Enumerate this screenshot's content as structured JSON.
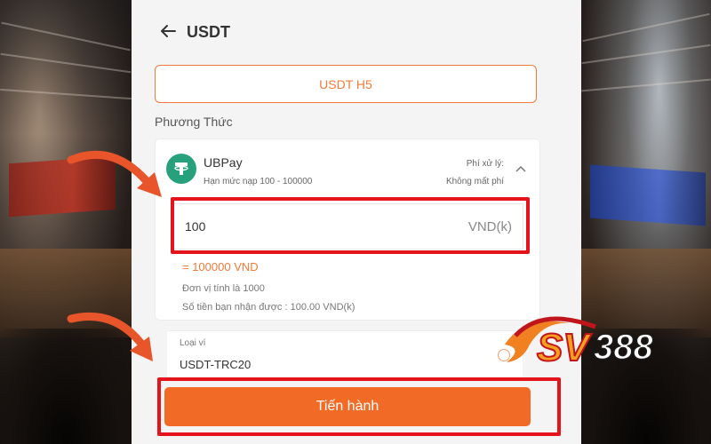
{
  "header": {
    "title": "USDT",
    "back_icon": "arrow-left-icon"
  },
  "tab": {
    "label": "USDT H5"
  },
  "method": {
    "section_label": "Phương Thức",
    "provider_name": "UBPay",
    "provider_icon": "tether-icon",
    "limit_text": "Hạn mức nạp 100 - 100000",
    "fee_label": "Phí xử lý:",
    "fee_value": "Không mất phí",
    "expand_icon": "chevron-up-icon"
  },
  "amount": {
    "value": "100",
    "unit": "VND(k)",
    "converted": "= 100000 VND",
    "unit_note": "Đơn vị tính là 1000",
    "receive_note": "Số tiền bạn nhận được : 100.00 VND(k)"
  },
  "wallet": {
    "label": "Loại ví",
    "value": "USDT-TRC20",
    "icon": "plus-circle-icon"
  },
  "submit": {
    "label": "Tiến hành"
  },
  "brand": {
    "logo_text": "SV388"
  },
  "colors": {
    "accent": "#f26b26",
    "highlight": "#e5141b",
    "tether": "#26a17b"
  }
}
